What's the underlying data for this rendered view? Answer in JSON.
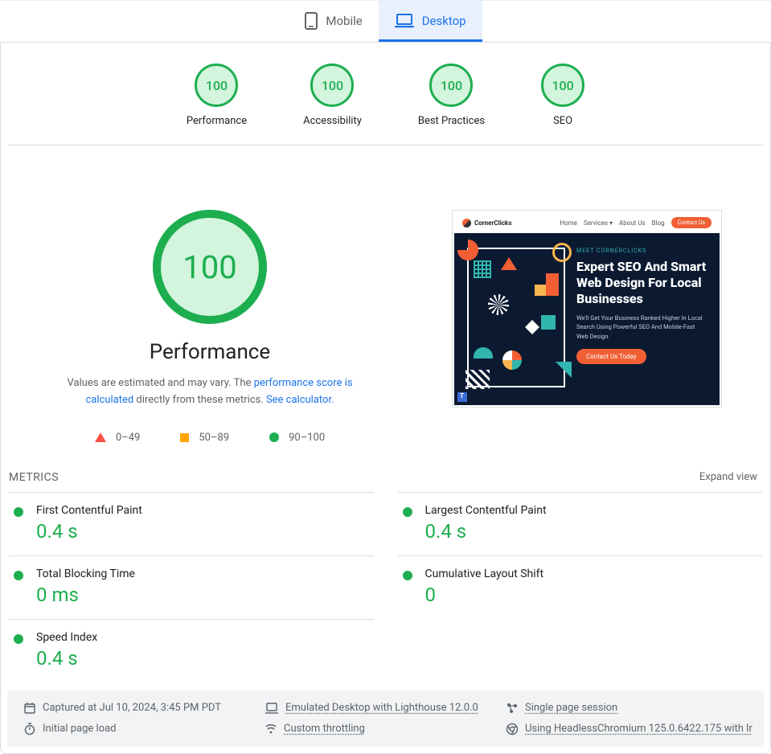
{
  "tabs": {
    "mobile": "Mobile",
    "desktop": "Desktop"
  },
  "summary": [
    {
      "score": "100",
      "label": "Performance"
    },
    {
      "score": "100",
      "label": "Accessibility"
    },
    {
      "score": "100",
      "label": "Best Practices"
    },
    {
      "score": "100",
      "label": "SEO"
    }
  ],
  "hero": {
    "score": "100",
    "title": "Performance",
    "desc_pre": "Values are estimated and may vary. The ",
    "desc_link1": "performance score is calculated",
    "desc_mid": " directly from these metrics. ",
    "desc_link2": "See calculator."
  },
  "legend": {
    "low": "0–49",
    "mid": "50–89",
    "high": "90–100"
  },
  "thumb": {
    "logo": "CornerClicks",
    "nav": [
      "Home",
      "Services ▾",
      "About Us",
      "Blog"
    ],
    "nav_cta": "Contact Us",
    "kicker": "MEET CORNERCLICKS",
    "headline": "Expert SEO And Smart Web Design For Local Businesses",
    "sub": "We'll Get Your Business Ranked Higher In Local Search Using Powerful SEO And Mobile-Fast Web Design.",
    "cta": "Contact Us Today"
  },
  "metrics_header": "METRICS",
  "expand": "Expand view",
  "metrics": [
    {
      "label": "First Contentful Paint",
      "value": "0.4 s"
    },
    {
      "label": "Largest Contentful Paint",
      "value": "0.4 s"
    },
    {
      "label": "Total Blocking Time",
      "value": "0 ms"
    },
    {
      "label": "Cumulative Layout Shift",
      "value": "0"
    },
    {
      "label": "Speed Index",
      "value": "0.4 s"
    }
  ],
  "footer": {
    "captured": "Captured at Jul 10, 2024, 3:45 PM PDT",
    "emulated": "Emulated Desktop with Lighthouse 12.0.0",
    "session": "Single page session",
    "load": "Initial page load",
    "throttling": "Custom throttling",
    "browser": "Using HeadlessChromium 125.0.6422.175 with lr"
  }
}
